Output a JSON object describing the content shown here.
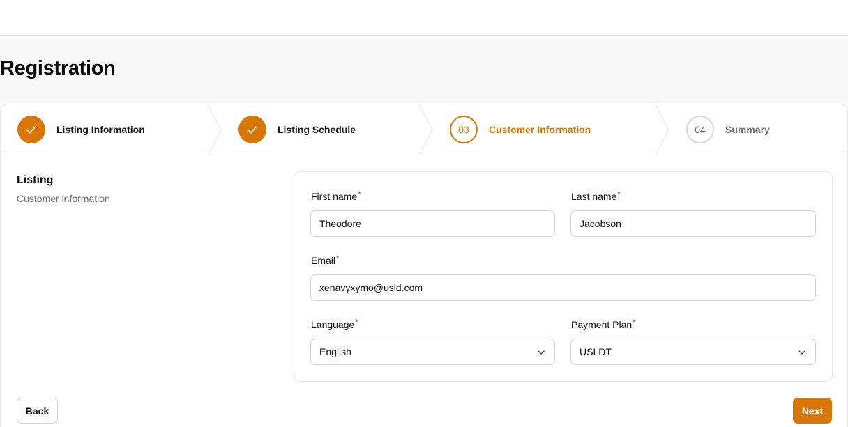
{
  "page": {
    "title": "Registration"
  },
  "steps": [
    {
      "label": "Listing Information",
      "status": "done",
      "number": "01"
    },
    {
      "label": "Listing Schedule",
      "status": "done",
      "number": "02"
    },
    {
      "label": "Customer Information",
      "status": "current",
      "number": "03"
    },
    {
      "label": "Summary",
      "status": "todo",
      "number": "04"
    }
  ],
  "section": {
    "title": "Listing",
    "subtitle": "Customer information"
  },
  "form": {
    "first_name": {
      "label": "First name",
      "value": "Theodore",
      "required_mark": "*"
    },
    "last_name": {
      "label": "Last name",
      "value": "Jacobson",
      "required_mark": "*"
    },
    "email": {
      "label": "Email",
      "value": "xenavyxymo@usld.com",
      "required_mark": "*"
    },
    "language": {
      "label": "Language",
      "value": "English",
      "required_mark": "*"
    },
    "payment_plan": {
      "label": "Payment Plan",
      "value": "USLDT",
      "required_mark": "*"
    }
  },
  "actions": {
    "back_label": "Back",
    "next_label": "Next"
  },
  "colors": {
    "accent": "#d97706",
    "required": "#dc2626",
    "muted": "#6b7280"
  },
  "icons": {
    "done_step": "check-icon",
    "select": "chevron-down-icon"
  }
}
